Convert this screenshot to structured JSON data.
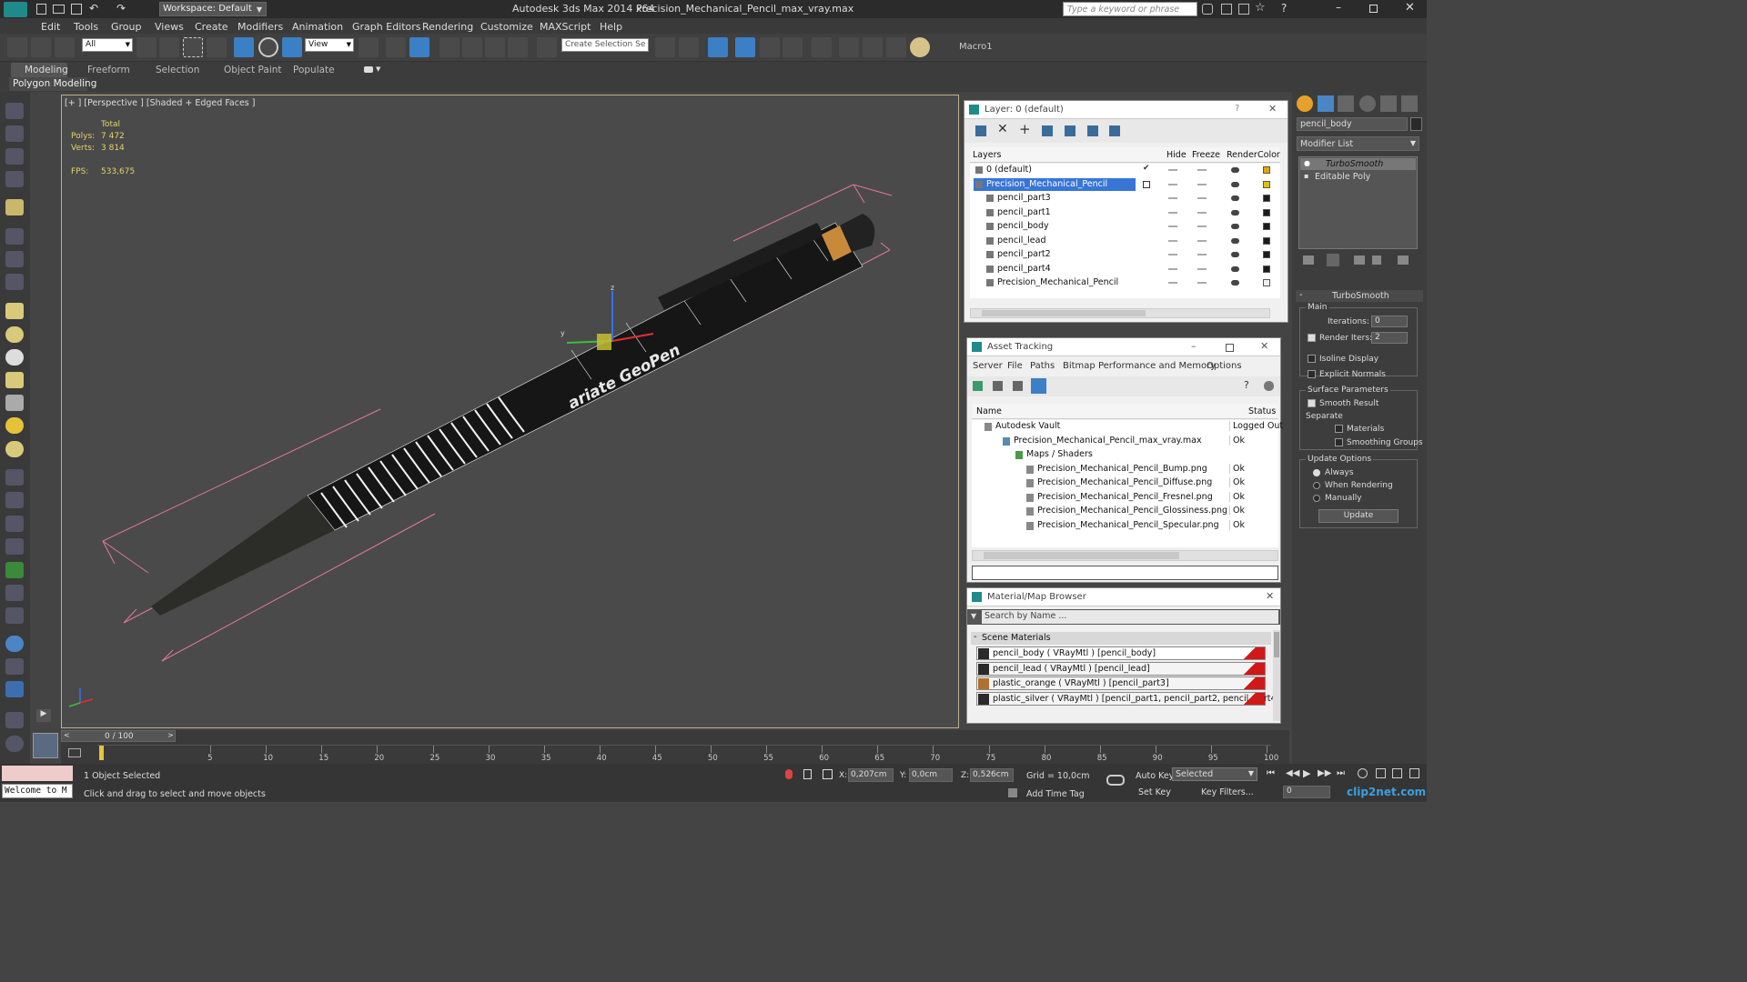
{
  "title_bar": {
    "workspace_label": "Workspace: Default",
    "app_title": "Autodesk 3ds Max  2014 x64",
    "file_title": "Precision_Mechanical_Pencil_max_vray.max",
    "search_placeholder": "Type a keyword or phrase"
  },
  "menu": [
    "Edit",
    "Tools",
    "Group",
    "Views",
    "Create",
    "Modifiers",
    "Animation",
    "Graph Editors",
    "Rendering",
    "Customize",
    "MAXScript",
    "Help"
  ],
  "toolbar": {
    "filter_value": "All",
    "refcoord_value": "View",
    "selection_set_placeholder": "Create Selection Se",
    "macro_label": "Macro1"
  },
  "ribbon": {
    "tabs": [
      "Modeling",
      "Freeform",
      "Selection",
      "Object Paint",
      "Populate"
    ],
    "subtab": "Polygon Modeling"
  },
  "viewport": {
    "label": "[+ ] [Perspective ] [Shaded + Edged Faces ]",
    "stats": {
      "total_label": "Total",
      "polys_label": "Polys:",
      "polys_value": "7 472",
      "verts_label": "Verts:",
      "verts_value": "3 814",
      "fps_label": "FPS:",
      "fps_value": "533,675"
    },
    "gizmo_axes": [
      "x",
      "y",
      "z"
    ],
    "pencil_text": "ariate GeoPen"
  },
  "layer_panel": {
    "title": "Layer: 0 (default)",
    "columns": [
      "Layers",
      "Hide",
      "Freeze",
      "Render",
      "Color"
    ],
    "rows": [
      {
        "name": "0 (default)",
        "color": "#e0a800",
        "indent": 1,
        "checked": true
      },
      {
        "name": "Precision_Mechanical_Pencil",
        "color": "#e0c000",
        "indent": 1,
        "selected": true
      },
      {
        "name": "pencil_part3",
        "color": "#1a1a1a",
        "indent": 2
      },
      {
        "name": "pencil_part1",
        "color": "#1a1a1a",
        "indent": 2
      },
      {
        "name": "pencil_body",
        "color": "#1a1a1a",
        "indent": 2
      },
      {
        "name": "pencil_lead",
        "color": "#1a1a1a",
        "indent": 2
      },
      {
        "name": "pencil_part2",
        "color": "#1a1a1a",
        "indent": 2
      },
      {
        "name": "pencil_part4",
        "color": "#1a1a1a",
        "indent": 2
      },
      {
        "name": "Precision_Mechanical_Pencil",
        "color": "#f0f0f0",
        "indent": 2
      }
    ]
  },
  "asset_tracking": {
    "title": "Asset Tracking",
    "menu": [
      "Server",
      "File",
      "Paths",
      "Bitmap Performance and Memory",
      "Options"
    ],
    "columns": [
      "Name",
      "Status"
    ],
    "rows": [
      {
        "name": "Autodesk Vault",
        "status": "Logged Out",
        "indent": 1
      },
      {
        "name": "Precision_Mechanical_Pencil_max_vray.max",
        "status": "Ok",
        "indent": 2
      },
      {
        "name": "Maps / Shaders",
        "status": "",
        "indent": 3
      },
      {
        "name": "Precision_Mechanical_Pencil_Bump.png",
        "status": "Ok",
        "indent": 4
      },
      {
        "name": "Precision_Mechanical_Pencil_Diffuse.png",
        "status": "Ok",
        "indent": 4
      },
      {
        "name": "Precision_Mechanical_Pencil_Fresnel.png",
        "status": "Ok",
        "indent": 4
      },
      {
        "name": "Precision_Mechanical_Pencil_Glossiness.png",
        "status": "Ok",
        "indent": 4
      },
      {
        "name": "Precision_Mechanical_Pencil_Specular.png",
        "status": "Ok",
        "indent": 4
      }
    ]
  },
  "material_browser": {
    "title": "Material/Map Browser",
    "search_placeholder": "Search by Name ...",
    "section": "Scene Materials",
    "items": [
      "pencil_body  ( VRayMtl ) [pencil_body]",
      "pencil_lead  ( VRayMtl ) [pencil_lead]",
      "plastic_orange  ( VRayMtl ) [pencil_part3]",
      "plastic_silver  ( VRayMtl ) [pencil_part1, pencil_part2, pencil_part4]"
    ]
  },
  "command_panel": {
    "object_name": "pencil_body",
    "modifier_list": "Modifier List",
    "stack": [
      "TurboSmooth",
      "Editable Poly"
    ],
    "rollout_title": "TurboSmooth",
    "main_label": "Main",
    "iterations_label": "Iterations:",
    "iterations_value": "0",
    "render_iters_label": "Render Iters:",
    "render_iters_value": "2",
    "isoline": "Isoline Display",
    "explicit": "Explicit Normals",
    "surface_label": "Surface Parameters",
    "smooth_result": "Smooth Result",
    "separate_label": "Separate",
    "materials": "Materials",
    "smoothing_groups": "Smoothing Groups",
    "update_options_label": "Update Options",
    "always": "Always",
    "when_rendering": "When Rendering",
    "manually": "Manually",
    "update_button": "Update"
  },
  "timeline": {
    "frame_display": "0 / 100",
    "ticks": [
      "5",
      "10",
      "15",
      "20",
      "25",
      "30",
      "35",
      "40",
      "45",
      "50",
      "55",
      "60",
      "65",
      "70",
      "75",
      "80",
      "85",
      "90",
      "95",
      "100"
    ]
  },
  "status": {
    "welcome": "Welcome to M",
    "selected_count": "1 Object Selected",
    "prompt": "Click and drag to select and move objects",
    "x_label": "X:",
    "x_value": "0,207cm",
    "y_label": "Y:",
    "y_value": "0,0cm",
    "z_label": "Z:",
    "z_value": "0,526cm",
    "grid": "Grid = 10,0cm",
    "add_time_tag": "Add Time Tag",
    "auto_key": "Auto Key",
    "set_key": "Set Key",
    "key_mode": "Selected",
    "key_filters": "Key Filters...",
    "frame_value": "0",
    "watermark": "clip2net.com"
  }
}
